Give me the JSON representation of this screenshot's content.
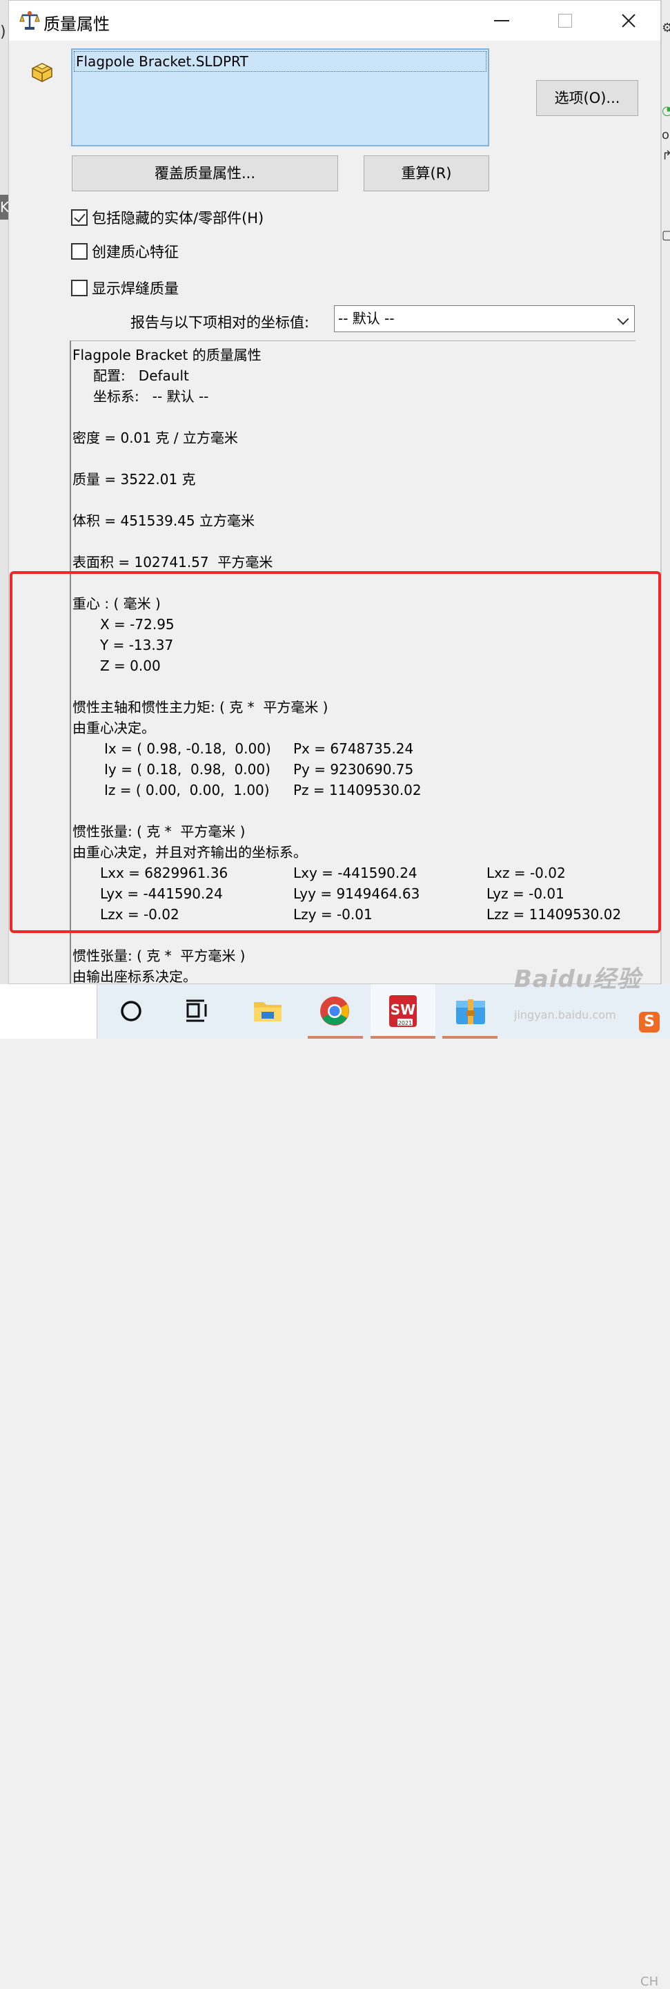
{
  "dialog": {
    "title": "质量属性",
    "file_name": "Flagpole Bracket.SLDPRT",
    "options_button": "选项(O)...",
    "override_button": "覆盖质量属性...",
    "recalc_button": "重算(R)",
    "checkboxes": [
      {
        "label": "包括隐藏的实体/零部件(H)",
        "checked": true
      },
      {
        "label": "创建质心特征",
        "checked": false
      },
      {
        "label": "显示焊缝质量",
        "checked": false
      }
    ],
    "coord_label": "报告与以下项相对的坐标值:",
    "coord_value": "-- 默认 --"
  },
  "results": {
    "header": "Flagpole Bracket 的质量属性",
    "config": "配置:   Default",
    "coord_sys": "坐标系:   -- 默认 --",
    "density": "密度 = 0.01 克 / 立方毫米",
    "mass": "质量 = 3522.01 克",
    "volume": "体积 = 451539.45 立方毫米",
    "area": "表面积 = 102741.57  平方毫米",
    "cog_title": "重心 : ( 毫米 )",
    "cog_x": "X = -72.95",
    "cog_y": "Y = -13.37",
    "cog_z": "Z = 0.00",
    "principal_title": "惯性主轴和惯性主力矩: ( 克 *  平方毫米 )",
    "principal_sub": "由重心决定。",
    "ix": "Ix = ( 0.98, -0.18,  0.00)",
    "iy": "Iy = ( 0.18,  0.98,  0.00)",
    "iz": "Iz = ( 0.00,  0.00,  1.00)",
    "px": "Px = 6748735.24",
    "py": "Py = 9230690.75",
    "pz": "Pz = 11409530.02",
    "tensor_title": "惯性张量: ( 克 *  平方毫米 )",
    "tensor_sub": "由重心决定，并且对齐输出的坐标系。",
    "lxx": "Lxx = 6829961.36",
    "lxy": "Lxy = -441590.24",
    "lxz": "Lxz = -0.02",
    "lyx": "Lyx = -441590.24",
    "lyy": "Lyy = 9149464.63",
    "lyz": "Lyz = -0.01",
    "lzx": "Lzx = -0.02",
    "lzy": "Lzy = -0.01",
    "lzz": "Lzz = 11409530.02",
    "tensor2_title": "惯性张量: ( 克 *  平方毫米 )",
    "tensor2_sub": "由输出座标系决定。"
  },
  "taskbar": {
    "sw_label": "2021",
    "watermark": "Baidu经验",
    "watermark_sub": "jingyan.baidu.com",
    "ime": "CH"
  },
  "colors": {
    "highlight": "#f0262b",
    "selection": "#cce4f7"
  }
}
